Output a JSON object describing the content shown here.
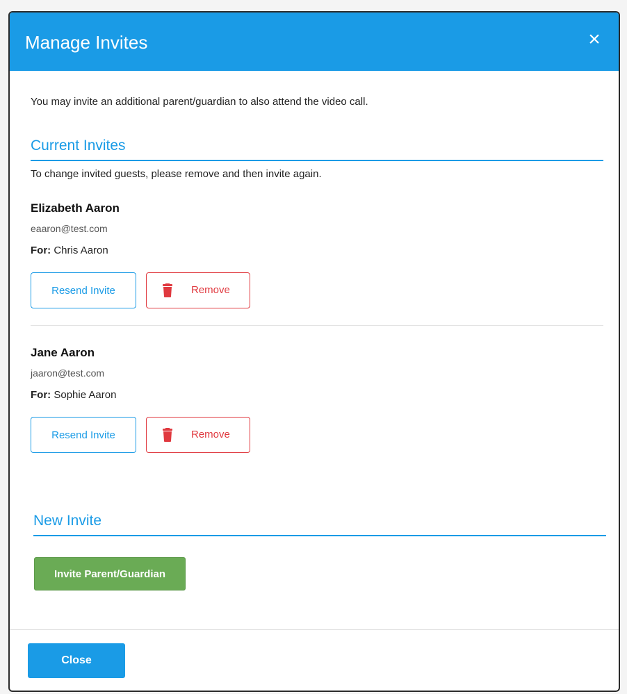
{
  "modal": {
    "title": "Manage Invites",
    "close_icon": "close-icon",
    "intro": "You may invite an additional parent/guardian to also attend the video call."
  },
  "current_invites": {
    "title": "Current Invites",
    "helper": "To change invited guests, please remove and then invite again.",
    "for_label": "For:",
    "items": [
      {
        "name": "Elizabeth Aaron",
        "email": "eaaron@test.com",
        "for": "Chris Aaron",
        "resend_label": "Resend Invite",
        "remove_label": "Remove"
      },
      {
        "name": "Jane Aaron",
        "email": "jaaron@test.com",
        "for": "Sophie Aaron",
        "resend_label": "Resend Invite",
        "remove_label": "Remove"
      }
    ]
  },
  "new_invite": {
    "title": "New Invite",
    "button_label": "Invite Parent/Guardian"
  },
  "footer": {
    "close_label": "Close"
  },
  "colors": {
    "primary": "#1a9be6",
    "danger": "#e0393f",
    "success": "#6aab55"
  },
  "icons": {
    "remove": "trash-icon"
  }
}
